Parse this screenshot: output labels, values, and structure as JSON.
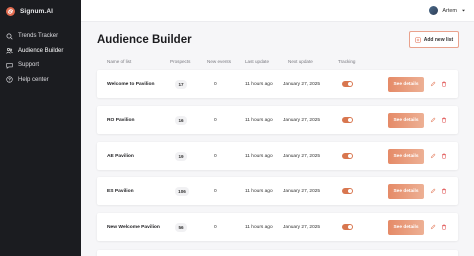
{
  "app": {
    "brand": "Signum.AI"
  },
  "sidebar": {
    "items": [
      {
        "label": "Trends Tracker",
        "icon": "search-icon"
      },
      {
        "label": "Audience Builder",
        "icon": "audience-icon",
        "active": true
      },
      {
        "label": "Support",
        "icon": "chat-icon"
      },
      {
        "label": "Help center",
        "icon": "help-icon"
      }
    ]
  },
  "topbar": {
    "user_name": "Artem"
  },
  "page": {
    "title": "Audience Builder",
    "add_button_label": "Add new list"
  },
  "table": {
    "columns": [
      "Name of list",
      "Prospects",
      "New events",
      "Last update",
      "Next update",
      "Tracking"
    ],
    "details_label": "See details",
    "rows": [
      {
        "name": "Welcome to Pavilion",
        "prospects": "17",
        "new_events": "0",
        "last_update": "11 hours ago",
        "next_update": "January 27, 2025"
      },
      {
        "name": "RO Pavilion",
        "prospects": "16",
        "new_events": "0",
        "last_update": "11 hours ago",
        "next_update": "January 27, 2025"
      },
      {
        "name": "AE Pavilion",
        "prospects": "19",
        "new_events": "0",
        "last_update": "11 hours ago",
        "next_update": "January 27, 2025"
      },
      {
        "name": "ES Pavilion",
        "prospects": "106",
        "new_events": "0",
        "last_update": "11 hours ago",
        "next_update": "January 27, 2025"
      },
      {
        "name": "New Welcome Pavilion",
        "prospects": "56",
        "new_events": "0",
        "last_update": "11 hours ago",
        "next_update": "January 27, 2025"
      }
    ]
  },
  "colors": {
    "accent": "#e58a67",
    "sidebar_bg": "#1b1c20",
    "toggle_on": "#d8764f",
    "delete_red": "#e05252"
  }
}
